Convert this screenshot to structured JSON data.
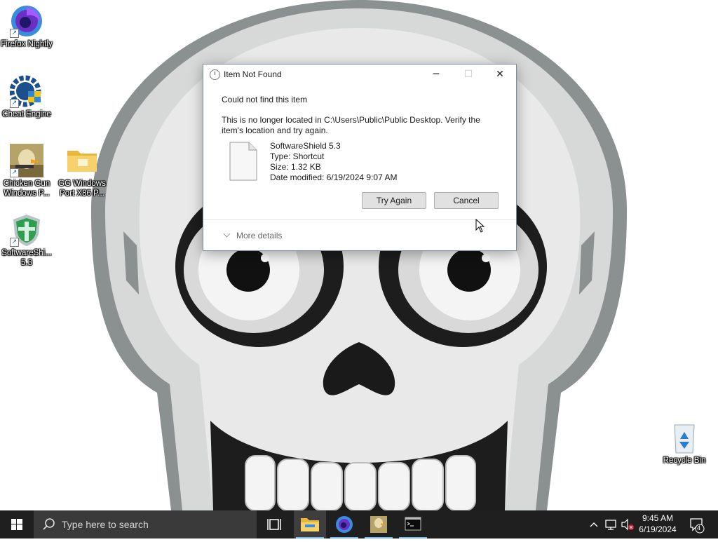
{
  "desktop": {
    "icons": [
      {
        "label": "Firefox Nightly",
        "icon": "firefox-nightly-icon"
      },
      {
        "label": "Cheat Engine",
        "icon": "cheat-engine-icon"
      },
      {
        "label": "Chicken Gun Windows P...",
        "icon": "chicken-gun-icon"
      },
      {
        "label": "GG Windows Port X86 P...",
        "icon": "folder-icon"
      },
      {
        "label": "SoftwareShi... 5.3",
        "icon": "softwareshield-icon"
      },
      {
        "label": "Recycle Bin",
        "icon": "recycle-bin-icon"
      }
    ]
  },
  "dialog": {
    "title": "Item Not Found",
    "heading": "Could not find this item",
    "message": "This is no longer located in C:\\Users\\Public\\Public Desktop. Verify the item's location and try again.",
    "file": {
      "name": "SoftwareShield 5.3",
      "type": "Type: Shortcut",
      "size": "Size: 1.32 KB",
      "modified": "Date modified: 6/19/2024 9:07 AM"
    },
    "try_again_label": "Try Again",
    "cancel_label": "Cancel",
    "more_details_label": "More details"
  },
  "taskbar": {
    "search_placeholder": "Type here to search",
    "apps": [
      "task-view-icon",
      "file-explorer-icon",
      "firefox-nightly-icon",
      "chicken-gun-icon",
      "terminal-icon"
    ],
    "time": "9:45 AM",
    "date": "6/19/2024",
    "notification_count": "4"
  },
  "colors": {
    "taskbar": "#1f1f1f",
    "accent": "#76b9ed",
    "wallpaper_bg": "#ffffff"
  }
}
